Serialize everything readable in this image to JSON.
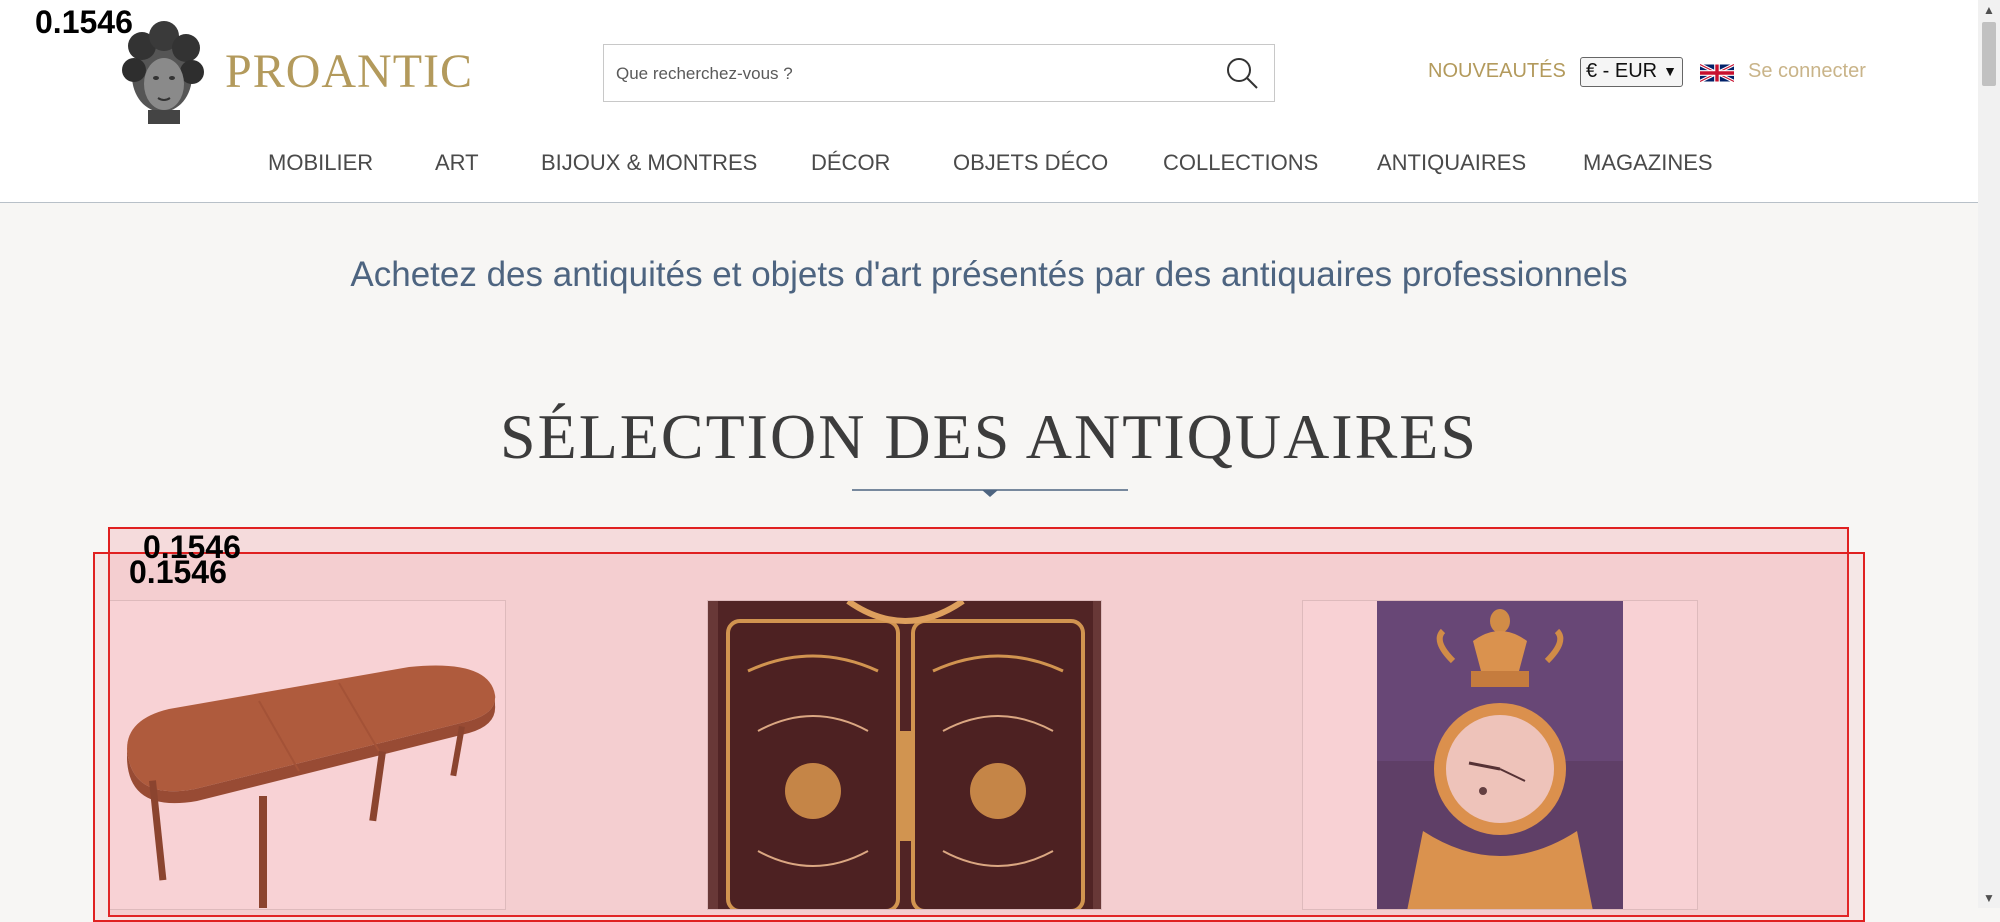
{
  "header": {
    "brand": "PROANTIC",
    "search": {
      "placeholder": "Que recherchez-vous ?",
      "value": ""
    },
    "new_link": "NOUVEAUTÉS",
    "currency": {
      "selected": "€ - EUR"
    },
    "language_flag": "uk-flag-icon",
    "login": "Se connecter"
  },
  "nav": {
    "items": [
      "MOBILIER",
      "ART",
      "BIJOUX & MONTRES",
      "DÉCOR",
      "OBJETS DÉCO",
      "COLLECTIONS",
      "ANTIQUAIRES",
      "MAGAZINES"
    ]
  },
  "main": {
    "tagline": "Achetez des antiquités et objets d'art présentés par des antiquaires professionnels",
    "section_title": "SÉLECTION DES ANTIQUAIRES",
    "products": [
      {
        "image": "wooden-oval-table-image"
      },
      {
        "image": "boulle-cabinet-image"
      },
      {
        "image": "gilt-bronze-clock-image"
      }
    ]
  },
  "overlay": {
    "scores": [
      "0.1546",
      "0.1546",
      "0.1546"
    ]
  },
  "colors": {
    "brand_gold": "#b39a5c",
    "tagline_blue": "#4d6480",
    "overlay_red": "#e02020"
  }
}
